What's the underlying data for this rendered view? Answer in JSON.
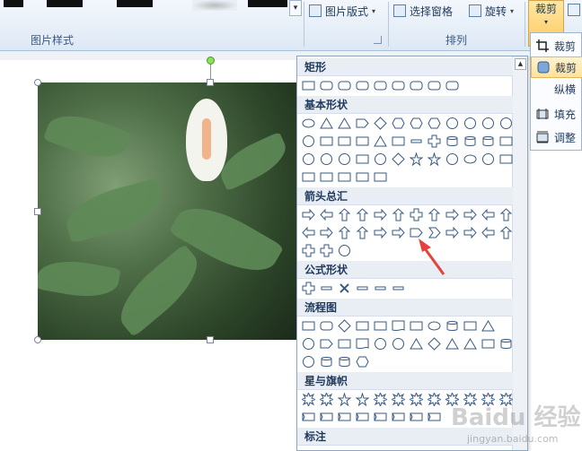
{
  "ribbon": {
    "picture_layout": "图片版式",
    "selection_pane": "选择窗格",
    "rotate": "旋转",
    "crop": "裁剪",
    "group_picture_styles": "图片样式",
    "group_arrange": "排列"
  },
  "side_menu": {
    "items": [
      "裁剪",
      "裁剪",
      "纵横",
      "填充",
      "调整"
    ]
  },
  "gallery": {
    "sections": [
      "矩形",
      "基本形状",
      "箭头总汇",
      "公式形状",
      "流程图",
      "星与旗帜",
      "标注"
    ]
  },
  "watermark": {
    "brand": "Baidu 经验",
    "url": "jingyan.baidu.com"
  },
  "colors": {
    "ribbon_bg": "#dde8f5",
    "crop_active": "#ffc85c",
    "arrow_annotation": "#e8413c",
    "shape_stroke": "#3a5a82"
  }
}
